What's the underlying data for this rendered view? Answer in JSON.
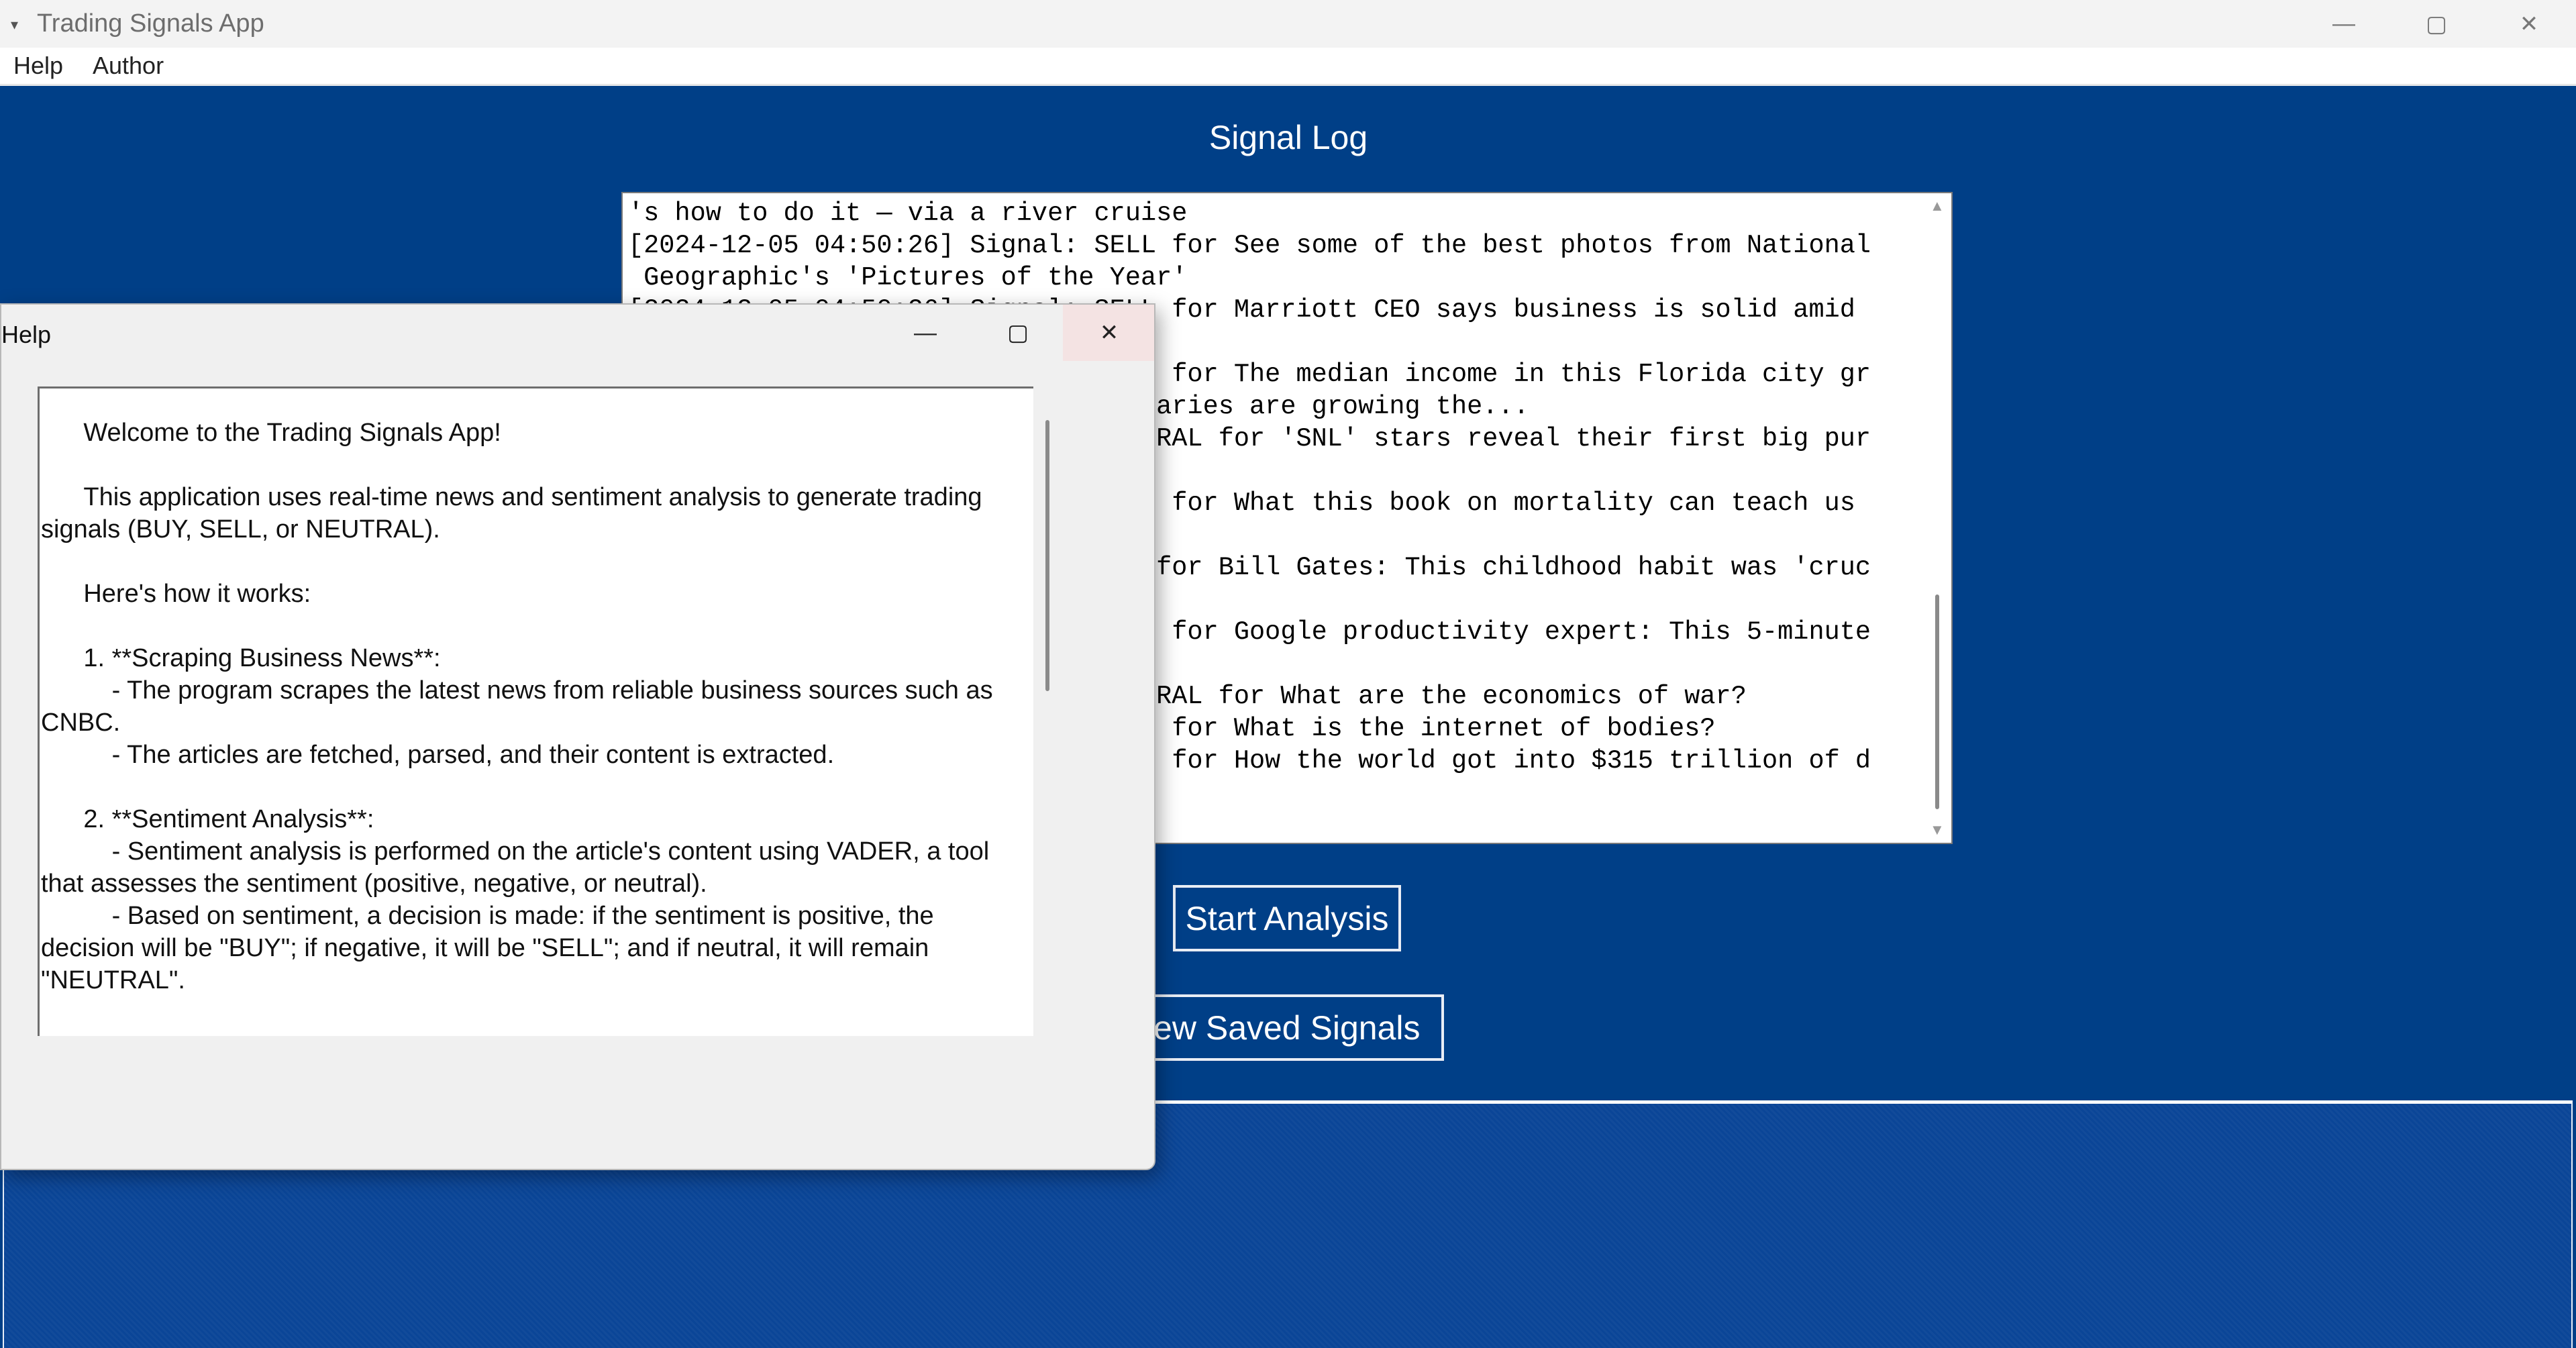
{
  "window": {
    "title": "Trading Signals App",
    "menu_glyph": "▾",
    "minimize_glyph": "—",
    "maximize_glyph": "▢",
    "close_glyph": "✕"
  },
  "menubar": {
    "items": [
      "Help",
      "Author"
    ]
  },
  "main": {
    "heading": "Signal Log",
    "log_lines": [
      "'s how to do it — via a river cruise",
      "[2024-12-05 04:50:26] Signal: SELL for See some of the best photos from National",
      " Geographic's 'Pictures of the Year'",
      "[2024-12-05 04:50:26] Signal: SELL for Marriott CEO says business is solid amid",
      "",
      "[2024-12-05 04:50:26] Signal: SELL for The median income in this Florida city gr",
      "ows faster than 7 cities where salaries are growing the...",
      "[2024-12-05 04:50:26] Signal: NEUTRAL for 'SNL' stars reveal their first big pur",
      "",
      "[2024-12-05 04:50:26] Signal: SELL for What this book on mortality can teach us",
      " about living our lives",
      "[2024-12-05 04:50:26] Signal: BUY for Bill Gates: This childhood habit was 'cruc",
      "",
      "[2024-12-05 04:50:26] Signal: SELL for Google productivity expert: This 5-minute",
      " trick gets things done",
      "[2024-12-05 04:50:26] Signal: NEUTRAL for What are the economics of war?",
      "[2024-12-05 04:50:26] Signal: SELL for What is the internet of bodies?",
      "[2024-12-05 04:50:26] Signal: SELL for How the world got into $315 trillion of d"
    ],
    "scroll_up": "▲",
    "scroll_down": "▼",
    "start_button": "Start Analysis",
    "view_button": "View Saved Signals"
  },
  "help_dialog": {
    "title": "Help",
    "minimize_glyph": "—",
    "maximize_glyph": "▢",
    "close_glyph": "✕",
    "text": "      Welcome to the Trading Signals App!\n\n      This application uses real-time news and sentiment analysis to generate trading signals (BUY, SELL, or NEUTRAL).\n\n      Here's how it works:\n\n      1. **Scraping Business News**:\n          - The program scrapes the latest news from reliable business sources such as CNBC.\n          - The articles are fetched, parsed, and their content is extracted.\n\n      2. **Sentiment Analysis**:\n          - Sentiment analysis is performed on the article's content using VADER, a tool that assesses the sentiment (positive, negative, or neutral).\n          - Based on sentiment, a decision is made: if the sentiment is positive, the decision will be \"BUY\"; if negative, it will be \"SELL\"; and if neutral, it will remain \"NEUTRAL\"."
  },
  "colors": {
    "client_bg": "#003f87",
    "button_border": "#e9edf5",
    "dialog_bg": "#f0f0f0"
  }
}
